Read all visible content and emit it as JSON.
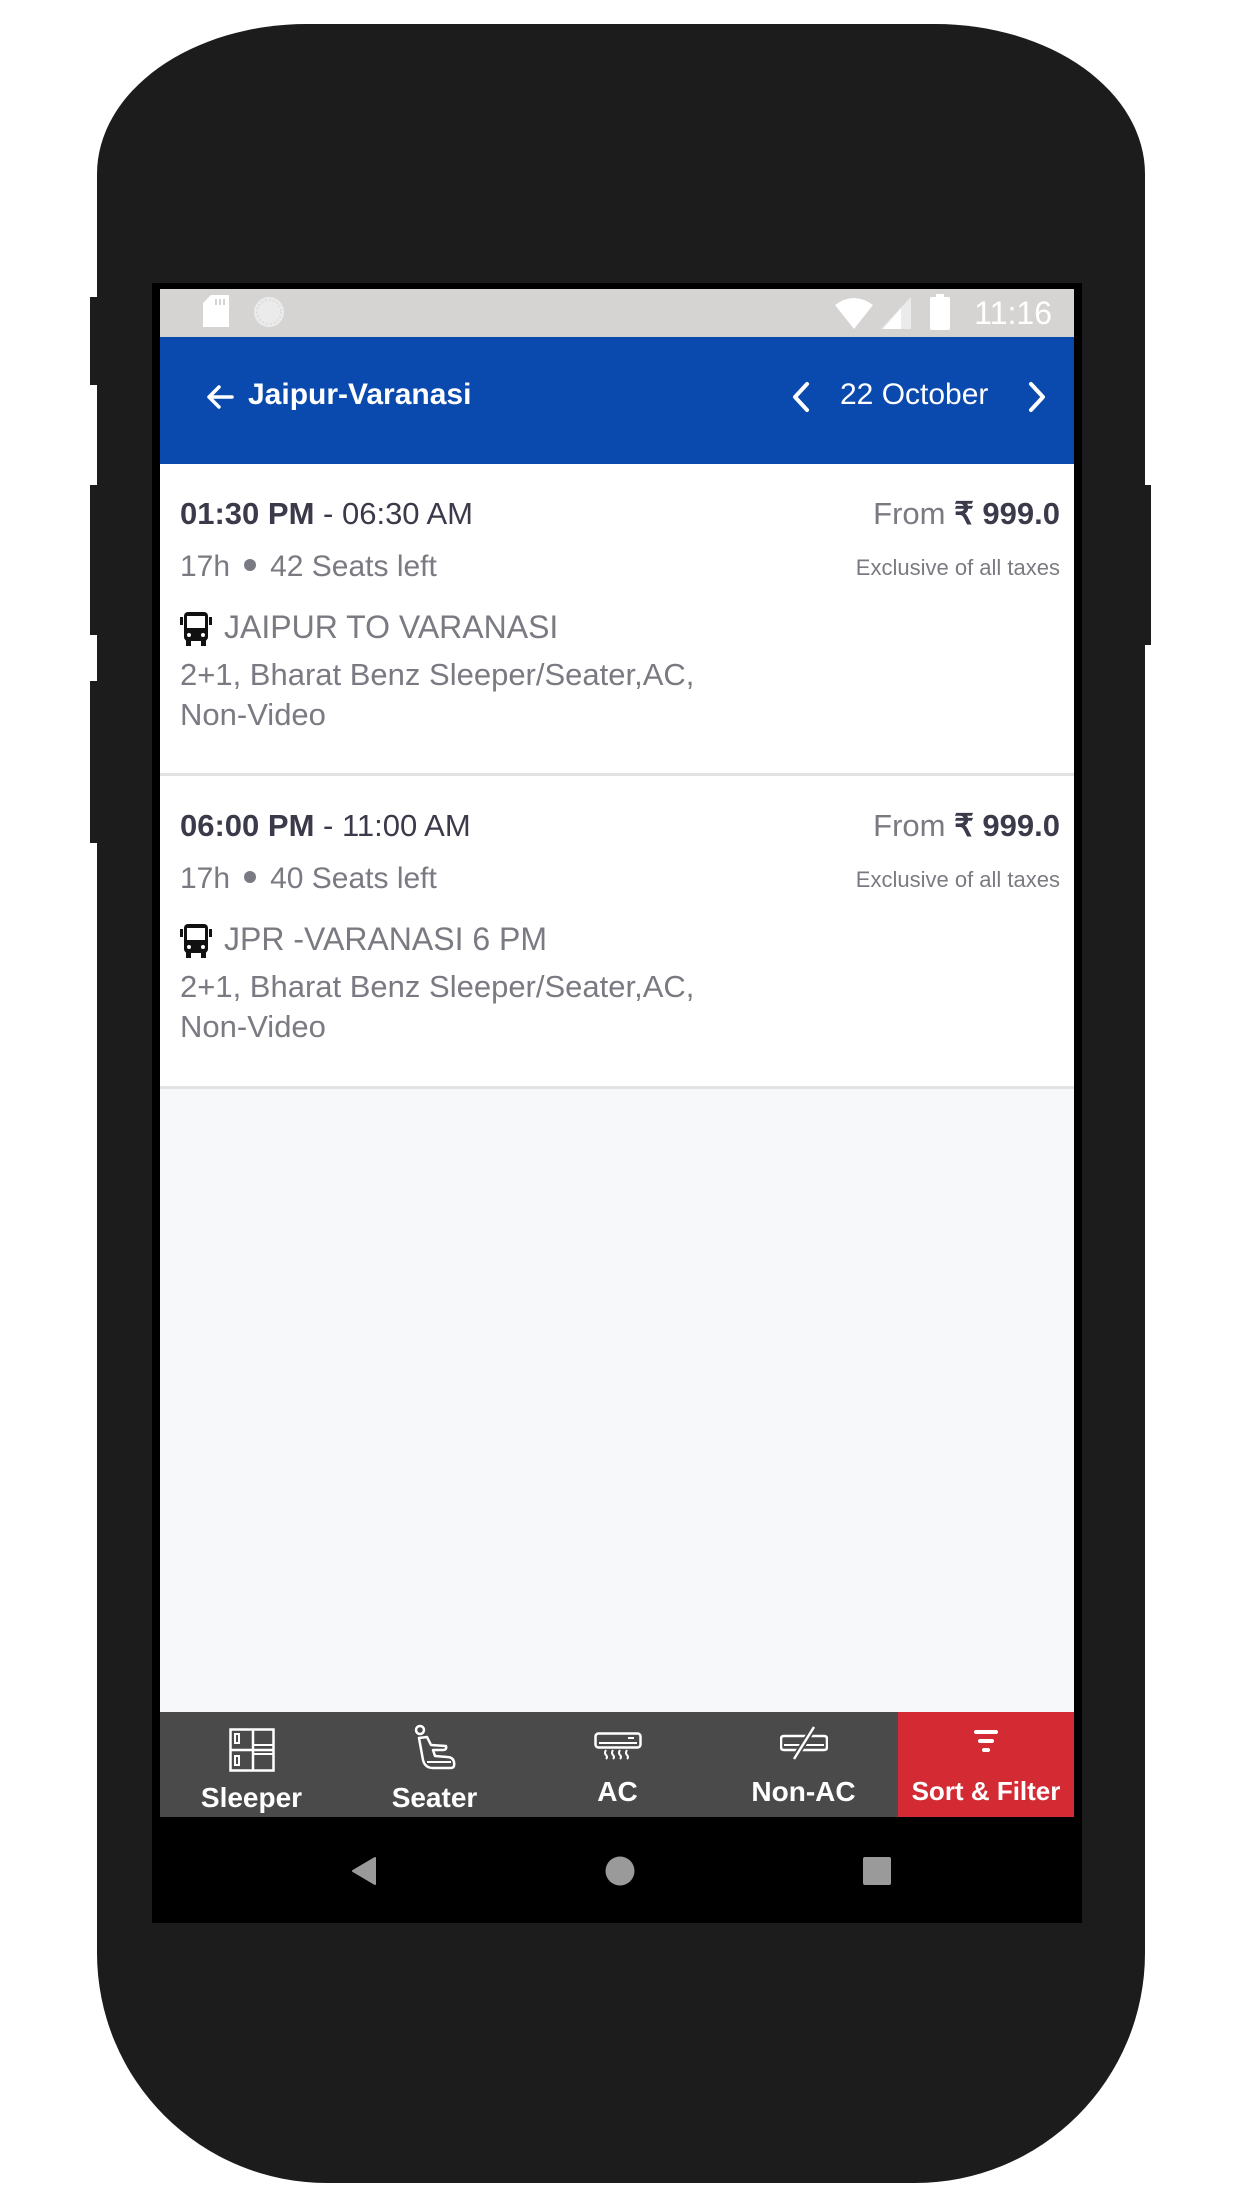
{
  "status_bar": {
    "time": "11:16",
    "left_icons": [
      "sd-card-icon",
      "sync-circle-icon"
    ],
    "right_icons": [
      "wifi-icon",
      "signal-icon",
      "battery-icon"
    ]
  },
  "header": {
    "back_icon": "arrow-left-icon",
    "title": "Jaipur-Varanasi",
    "prev_date_icon": "chevron-left-icon",
    "date": "22 October",
    "next_date_icon": "chevron-right-icon"
  },
  "buses": [
    {
      "departure": "01:30 PM",
      "arrival_sep": " - ",
      "arrival": "06:30 AM",
      "duration": "17h",
      "seats_left": "42 Seats left",
      "operator_icon": "bus-icon",
      "name": "JAIPUR TO VARANASI",
      "description": "2+1, Bharat Benz Sleeper/Seater,AC, Non-Video",
      "price_prefix": "From ",
      "price": "₹ 999.0",
      "tax_note": "Exclusive of all taxes"
    },
    {
      "departure": "06:00 PM",
      "arrival_sep": " - ",
      "arrival": "11:00 AM",
      "duration": "17h",
      "seats_left": "40 Seats left",
      "operator_icon": "bus-icon",
      "name": "JPR -VARANASI 6 PM",
      "description": "2+1, Bharat Benz Sleeper/Seater,AC, Non-Video",
      "price_prefix": "From ",
      "price": "₹ 999.0",
      "tax_note": "Exclusive of all taxes"
    }
  ],
  "tabs": [
    {
      "label": "Sleeper",
      "icon": "sleeper-berth-icon"
    },
    {
      "label": "Seater",
      "icon": "seat-icon"
    },
    {
      "label": "AC",
      "icon": "air-conditioner-icon"
    },
    {
      "label": "Non-AC",
      "icon": "no-ac-icon"
    },
    {
      "label": "Sort & Filter",
      "icon": "filter-icon"
    }
  ],
  "colors": {
    "header_blue": "#0a4aaf",
    "tab_bar": "#4a4a4a",
    "sort_filter_red": "#d32a33",
    "text_dark": "#3a3a4a",
    "text_gray": "#7a7a82"
  },
  "nav_bar": {
    "buttons": [
      "nav-back-icon",
      "nav-home-icon",
      "nav-recents-icon"
    ]
  }
}
